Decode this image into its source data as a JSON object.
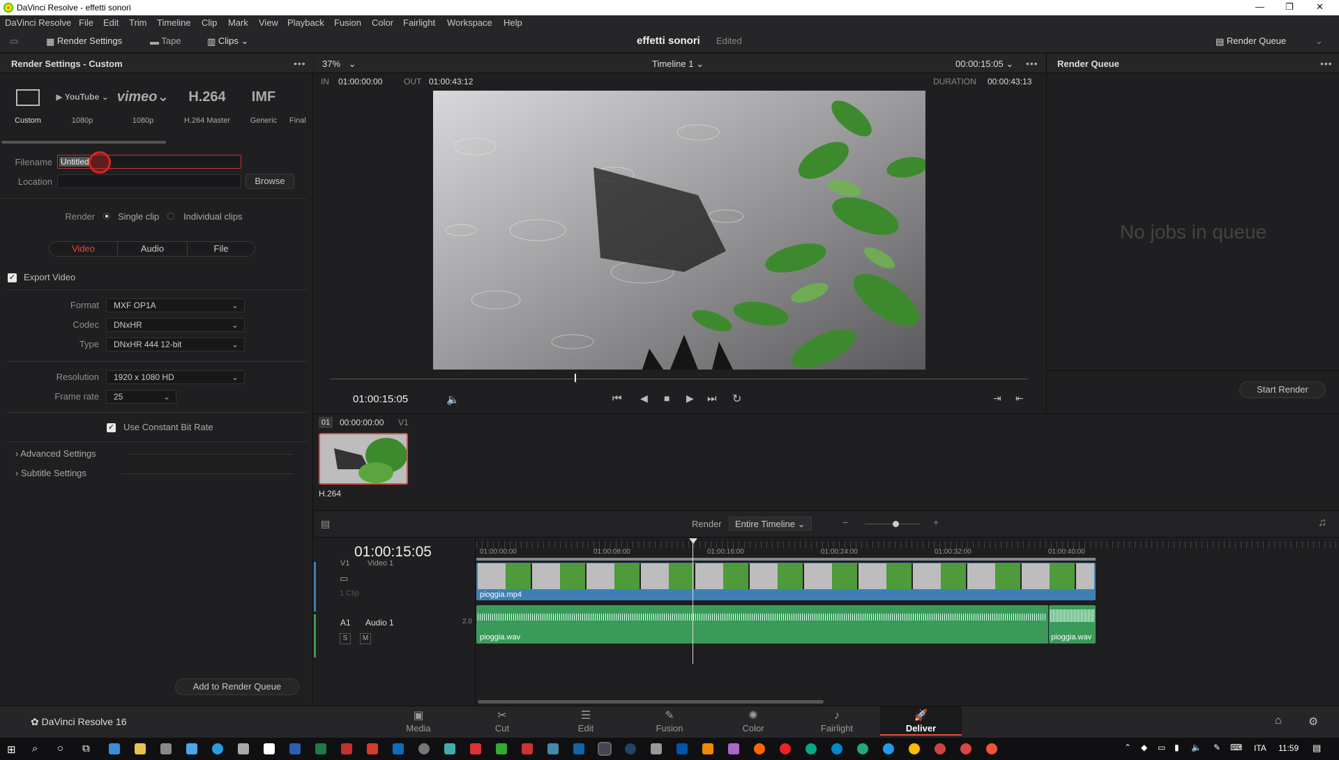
{
  "window": {
    "title": "DaVinci Resolve - effetti sonori"
  },
  "menu": [
    "DaVinci Resolve",
    "File",
    "Edit",
    "Trim",
    "Timeline",
    "Clip",
    "Mark",
    "View",
    "Playback",
    "Fusion",
    "Color",
    "Fairlight",
    "Workspace",
    "Help"
  ],
  "toolbar": {
    "render_settings": "Render Settings",
    "tape": "Tape",
    "clips": "Clips",
    "project_name": "effetti sonori",
    "project_status": "Edited",
    "render_queue": "Render Queue"
  },
  "render_settings": {
    "header": "Render Settings - Custom",
    "presets": [
      {
        "name": "Custom",
        "sub": "Custom"
      },
      {
        "name": "YouTube",
        "sub": "1080p"
      },
      {
        "name": "vimeo",
        "sub": "1080p"
      },
      {
        "name": "H.264",
        "sub": "H.264 Master"
      },
      {
        "name": "IMF",
        "sub": "Generic"
      },
      {
        "name": "",
        "sub": "Final"
      }
    ],
    "filename_label": "Filename",
    "filename_value": "Untitled",
    "location_label": "Location",
    "location_value": "",
    "browse_label": "Browse",
    "render_label": "Render",
    "single_clip": "Single clip",
    "individual_clips": "Individual clips",
    "tabs": [
      "Video",
      "Audio",
      "File"
    ],
    "export_video": "Export Video",
    "format_label": "Format",
    "format_value": "MXF OP1A",
    "codec_label": "Codec",
    "codec_value": "DNxHR",
    "type_label": "Type",
    "type_value": "DNxHR 444 12-bit",
    "resolution_label": "Resolution",
    "resolution_value": "1920 x 1080 HD",
    "framerate_label": "Frame rate",
    "framerate_value": "25",
    "constant_bitrate": "Use Constant Bit Rate",
    "advanced": "Advanced Settings",
    "subtitle": "Subtitle Settings",
    "add_to_queue": "Add to Render Queue"
  },
  "viewer": {
    "zoom": "37%",
    "timeline_name": "Timeline 1",
    "timecode_top": "00:00:15:05",
    "in_label": "IN",
    "in_value": "01:00:00:00",
    "out_label": "OUT",
    "out_value": "01:00:43:12",
    "duration_label": "DURATION",
    "duration_value": "00:00:43:13",
    "current_tc": "01:00:15:05",
    "scrub_progress": 0.35
  },
  "queue": {
    "title": "Render Queue",
    "empty": "No jobs in queue",
    "start_render": "Start Render"
  },
  "bins": {
    "clip_num": "01",
    "clip_tc": "00:00:00:00",
    "clip_track": "V1",
    "clip_codec": "H.264"
  },
  "timeline": {
    "render_label": "Render",
    "render_range": "Entire Timeline",
    "timecode": "01:00:15:05",
    "ruler": [
      "01:00:00:00",
      "01:00:08:00",
      "01:00:16:00",
      "01:00:24:00",
      "01:00:32:00",
      "01:00:40:00"
    ],
    "video_track": "Video 1",
    "video_track_id": "V1",
    "clip_count": "1 Clip",
    "video_clip": "pioggia.mp4",
    "audio_track_id": "A1",
    "audio_track": "Audio 1",
    "audio_channels": "2.0",
    "solo": "S",
    "mute": "M",
    "audio_clip1": "pioggia.wav",
    "audio_clip2": "pioggia.wav"
  },
  "pages": [
    "Media",
    "Cut",
    "Edit",
    "Fusion",
    "Color",
    "Fairlight",
    "Deliver"
  ],
  "app_version": "DaVinci Resolve 16",
  "taskbar": {
    "lang": "ITA",
    "time": "11:59"
  },
  "colors": {
    "accent": "#e64b3c",
    "clip_blue": "#3e7fb5",
    "audio_green": "#3a9a5a"
  }
}
